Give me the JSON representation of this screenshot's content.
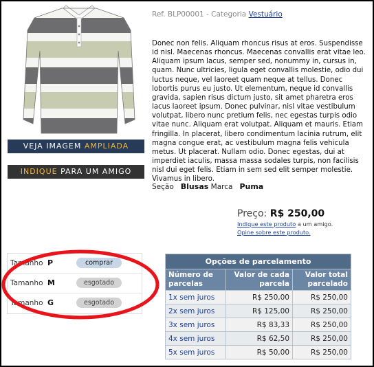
{
  "product": {
    "ref_prefix": "Ref. BLP00001 - Categoria",
    "category": "Vestuário",
    "description": "Donec non felis. Aliquam rhoncus risus at eros. Suspendisse id nisl. Maecenas rhoncus. Maecenas convallis erat vitae leo. Aliquam ipsum lacus, semper sed, nonummy in, cursus in, quam. Nunc ultricies, ligula eget convallis molestie, odio dui luctus neque, vel laoreet quam neque at tellus. Donec lobortis purus eu justo. Ut elementum, neque id convallis gravida, sapien risus dictum justo, sit amet pharetra eros lacus laoreet ipsum. Donec pulvinar, nisl vitae vestibulum volutpat, libero nunc pretium felis, nec egestas turpis odio vitae nunc. Aliquam erat volutpat. Aliquam et mauris. Etiam fringilla. In placerat, libero condimentum lacinia rutrum, elit magna congue erat, ac vestibulum magna felis vehicula metus. Ut placerat. Nullam odio. Donec egestas, dui at imperdiet iaculis, massa massa sodales turpis, non facilisis nisl dui eget felis. Etiam in sem sed elit semper molestie. Vivamus in libero.",
    "section_label": "Seção",
    "section_value": "Blusas",
    "brand_label": "Marca",
    "brand_value": "Puma",
    "price_label": "Preço:",
    "price_value": "R$ 250,00",
    "share_link": "Indique este produto",
    "share_suffix": "a um amigo.",
    "opine_link": "Opine sobre este produto."
  },
  "buttons": {
    "ampliada_a": "VEJA IMAGEM",
    "ampliada_b": "AMPLIADA",
    "indique_a": "INDIQUE",
    "indique_b": "PARA UM AMIGO"
  },
  "sizes": [
    {
      "label": "Tamanho",
      "code": "P",
      "action": "comprar",
      "available": true
    },
    {
      "label": "Tamanho",
      "code": "M",
      "action": "esgotado",
      "available": false
    },
    {
      "label": "Tamanho",
      "code": "G",
      "action": "esgotado",
      "available": false
    }
  ],
  "installments": {
    "title": "Opções de parcelamento",
    "headers": [
      "Número de parcelas",
      "Valor de cada parcela",
      "Valor total parcelado"
    ],
    "rows": [
      {
        "n": "1x",
        "label": "sem juros",
        "each": "R$ 250,00",
        "total": "R$ 250,00"
      },
      {
        "n": "2x",
        "label": "sem juros",
        "each": "R$ 125,00",
        "total": "R$ 250,00"
      },
      {
        "n": "3x",
        "label": "sem juros",
        "each": "R$ 83,33",
        "total": "R$ 250,00"
      },
      {
        "n": "4x",
        "label": "sem juros",
        "each": "R$ 62,50",
        "total": "R$ 250,00"
      },
      {
        "n": "5x",
        "label": "sem juros",
        "each": "R$ 50,00",
        "total": "R$ 250,00"
      }
    ]
  },
  "colors": {
    "link": "#1a3f9a",
    "highlight_ring": "#e8141c",
    "table_header": "#4f6b88",
    "button_dark": "#273a58",
    "button_accent": "#f0b73a"
  }
}
